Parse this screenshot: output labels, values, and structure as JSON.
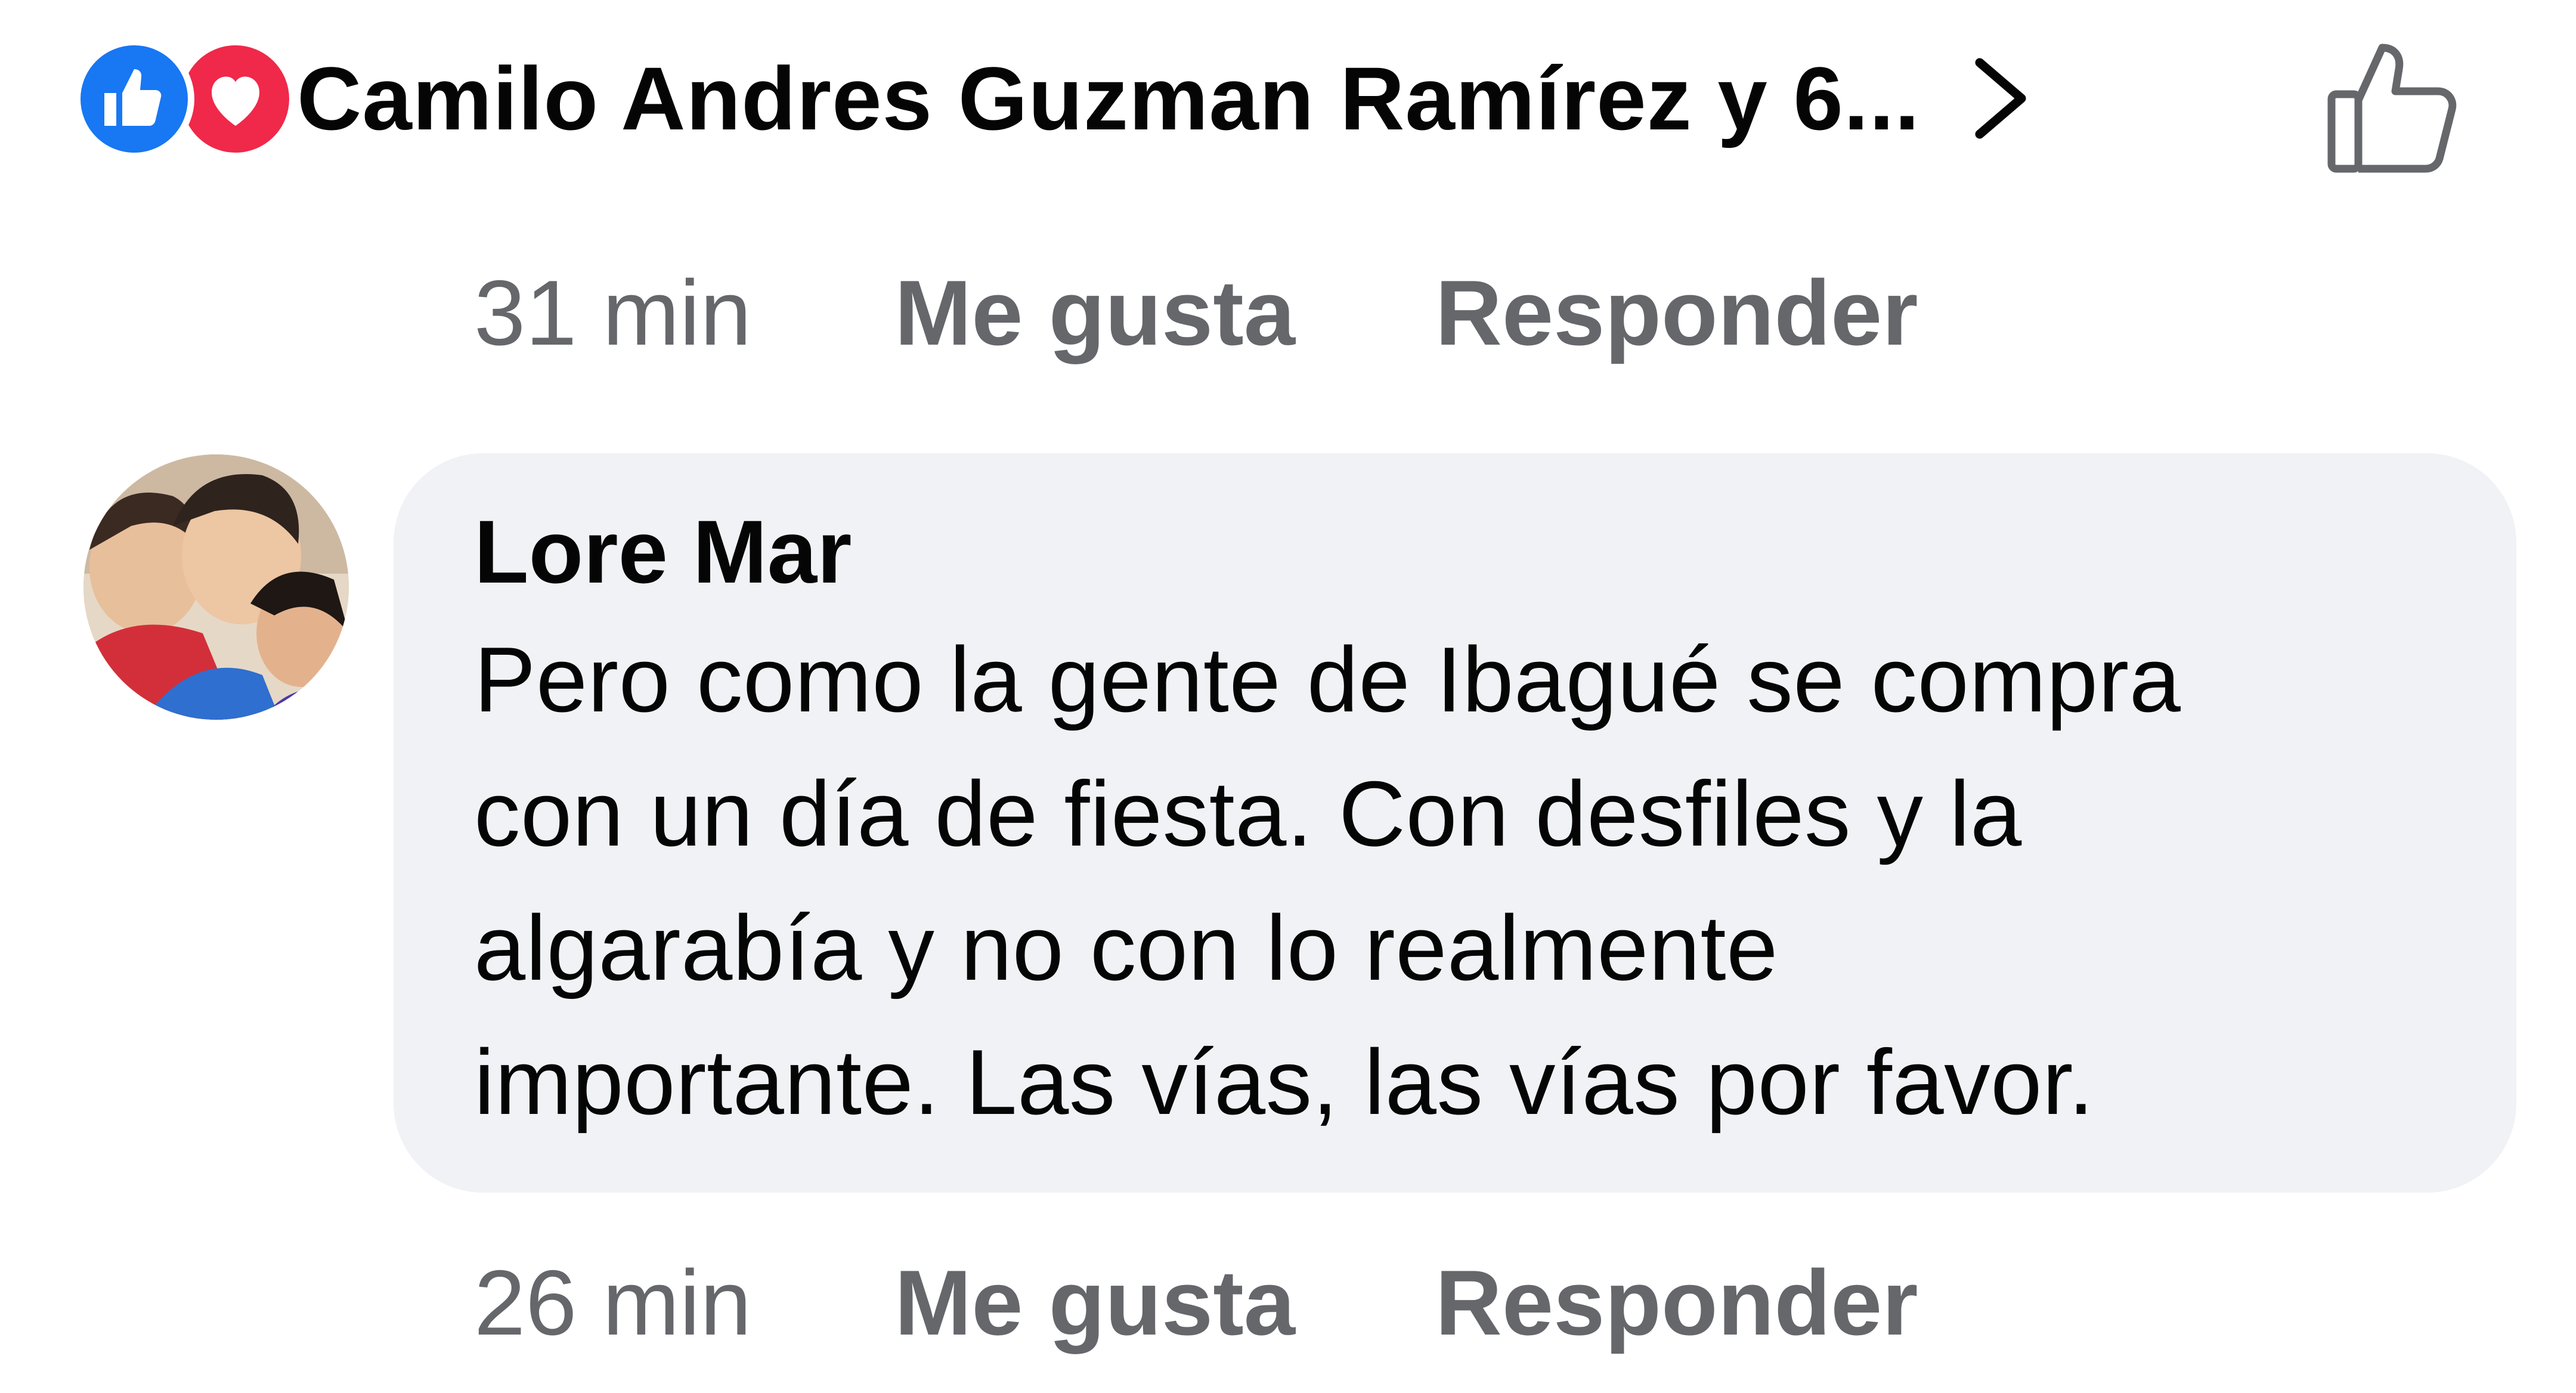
{
  "reactions": {
    "icons": [
      "thumbs-up-icon",
      "heart-icon"
    ],
    "text": "Camilo Andres Guzman Ramírez y 6...",
    "colors": {
      "like": "#1877f2",
      "love": "#f0284a"
    }
  },
  "top_comment_meta": {
    "time": "31 min",
    "like_label": "Me gusta",
    "reply_label": "Responder"
  },
  "comment": {
    "author": "Lore Mar",
    "text": "Pero como la gente de Ibagué se compra\ncon un día de fiesta. Con desfiles y la\nalgarabía y no con lo realmente\nimportante. Las vías, las vías por favor.",
    "bubble_color": "#f0f2f5"
  },
  "comment_meta": {
    "time": "26 min",
    "like_label": "Me gusta",
    "reply_label": "Responder"
  },
  "theme": {
    "meta_text": "#65676b",
    "text": "#050505"
  }
}
